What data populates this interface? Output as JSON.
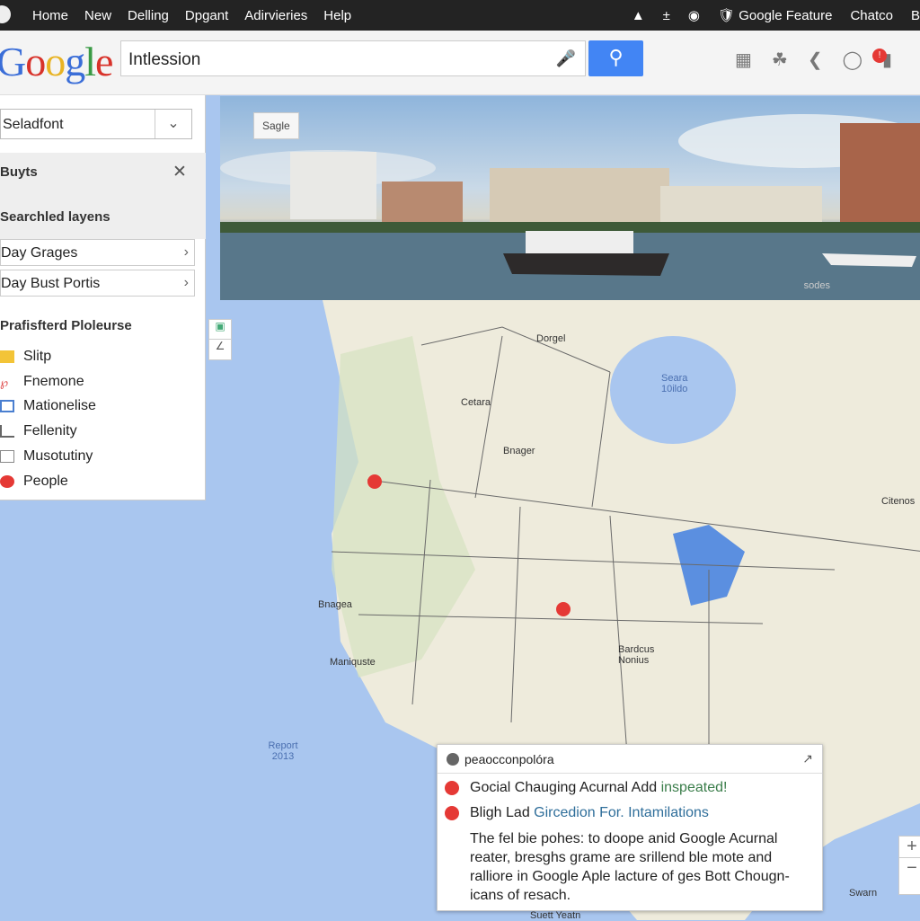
{
  "topbar": {
    "nav": [
      "Home",
      "New",
      "Delling",
      "Dpgant",
      "Adirvieries",
      "Help"
    ],
    "right_feature": "Google Feature",
    "right_user": "Chatco",
    "right_more": "B"
  },
  "search": {
    "logo": "Google",
    "query": "Intlession",
    "button_icon": "search-icon"
  },
  "panel": {
    "select_value": "Seladfont",
    "section1": "Buyts",
    "section2": "Searchled layens",
    "rows": [
      "Day Grages",
      "Day Bust Portis"
    ],
    "section3": "Prafisfterd Ploleurse",
    "items": [
      "Slitp",
      "Fnemone",
      "Mationelise",
      "Fellenity",
      "Musotutiny",
      "People"
    ]
  },
  "photo": {
    "badge": "Sagle",
    "watermark": "sodes"
  },
  "map": {
    "labels": [
      "Dorgel",
      "Seara 10ildo",
      "Cetara",
      "Bnager",
      "Citenos",
      "Bnagea",
      "Maniquste",
      "Bardcus Nonius",
      "Report 2013",
      "Swarn",
      "Suett Yeatn"
    ],
    "colors": {
      "water": "#a9c6ef",
      "land": "#eeebdc",
      "marker": "#e53935"
    }
  },
  "popup": {
    "title": "peaocconpolóra",
    "line1_a": "Gocial Chauging Acurnal Add ",
    "line1_b": "inspeated!",
    "line2_a": "Bligh Lad ",
    "line2_b": "Gircedion For. Intamilations",
    "body": "The fel bie pohes: to doope anid Google Acurnal reater, bresghs grame are srillend ble mote and ralliore in Google Aple lacture of ges Bott Chougn-icans of resach."
  }
}
